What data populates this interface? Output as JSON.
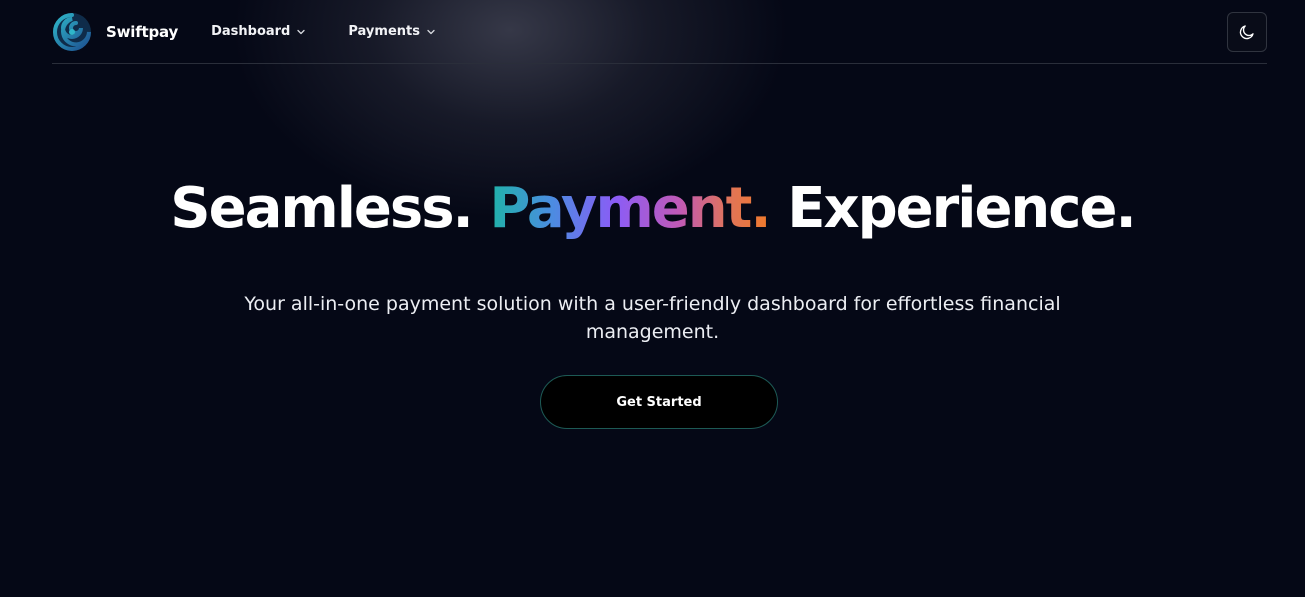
{
  "brand": {
    "name": "Swiftpay",
    "logo_icon": "swirl-logo-icon"
  },
  "nav": {
    "items": [
      {
        "label": "Dashboard",
        "icon": "chevron-down-icon"
      },
      {
        "label": "Payments",
        "icon": "chevron-down-icon"
      }
    ]
  },
  "theme_toggle": {
    "icon": "moon-icon"
  },
  "hero": {
    "headline": {
      "part1": "Seamless.",
      "part2": "Payment.",
      "part3": "Experience."
    },
    "subtitle": "Your all-in-one payment solution with a user-friendly dashboard for effortless financial management.",
    "cta_label": "Get Started"
  },
  "colors": {
    "background": "#050816",
    "gradient_start": "#1fb3a8",
    "gradient_mid": "#8b5cf6",
    "gradient_end": "#f07a2a",
    "cta_border": "#1d5a55"
  }
}
